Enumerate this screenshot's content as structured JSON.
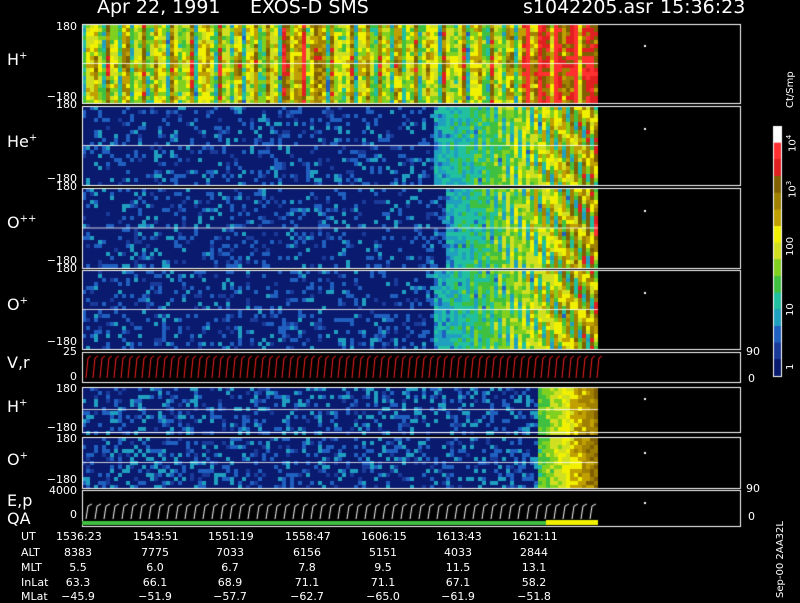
{
  "header": {
    "date": "Apr 22, 1991",
    "instrument": "EXOS-D SMS",
    "file": "s1042205.asr",
    "time": "15:36:23"
  },
  "colors": {
    "background": "#000000",
    "axis": "#ffffff",
    "vr_trace": "#ff2020",
    "ep_trace": "#ffffff",
    "qa_bar": "#40c040"
  },
  "panels": [
    {
      "id": "h-plus-1",
      "label": "H+",
      "ticks": {
        "top": "180",
        "bottom": "−180"
      },
      "onset": 0.05,
      "strength": 1.0
    },
    {
      "id": "he-plus",
      "label": "He+",
      "ticks": {
        "top": "180",
        "bottom": "−180"
      },
      "onset": 0.68,
      "strength": 0.9
    },
    {
      "id": "o-plus-plus",
      "label": "O++",
      "ticks": {
        "top": "180",
        "bottom": "−180"
      },
      "onset": 0.7,
      "strength": 0.95
    },
    {
      "id": "o-plus-1",
      "label": "O+",
      "ticks": {
        "top": "180",
        "bottom": "−180"
      },
      "onset": 0.68,
      "strength": 0.9
    },
    {
      "id": "h-plus-2",
      "label": "H+",
      "ticks": {
        "top": "180",
        "bottom": "−180"
      },
      "onset": 0.88,
      "strength": 0.8
    },
    {
      "id": "o-plus-2",
      "label": "O+",
      "ticks": {
        "top": "180",
        "bottom": "−180"
      },
      "onset": 0.88,
      "strength": 0.7
    }
  ],
  "vr_panel": {
    "label": "V,r",
    "left_ticks": [
      "25",
      "0"
    ],
    "right_ticks": [
      "90",
      "0"
    ]
  },
  "ep_panel": {
    "label": "E,p",
    "qa_label": "QA",
    "left_ticks": [
      "4000",
      "0"
    ],
    "right_ticks": [
      "90",
      "0"
    ]
  },
  "colorbar": {
    "unit": "Ct/Smp",
    "ticks": [
      {
        "base": "10",
        "exp": "4",
        "level": 4
      },
      {
        "base": "10",
        "exp": "3",
        "level": 3
      },
      {
        "base": "100",
        "exp": "",
        "level": 2
      },
      {
        "base": "10",
        "exp": "",
        "level": 1
      },
      {
        "base": "1",
        "exp": "",
        "level": 0
      }
    ]
  },
  "footer": {
    "row_labels": [
      "UT",
      "ALT",
      "MLT",
      "InLat",
      "MLat"
    ],
    "columns": [
      {
        "UT": "1536:23",
        "ALT": "8383",
        "MLT": "5.5",
        "InLat": "63.3",
        "MLat": "−45.9"
      },
      {
        "UT": "1543:51",
        "ALT": "7775",
        "MLT": "6.0",
        "InLat": "66.1",
        "MLat": "−51.9"
      },
      {
        "UT": "1551:19",
        "ALT": "7033",
        "MLT": "6.7",
        "InLat": "68.9",
        "MLat": "−57.7"
      },
      {
        "UT": "1558:47",
        "ALT": "6156",
        "MLT": "7.8",
        "InLat": "71.1",
        "MLat": "−62.7"
      },
      {
        "UT": "1606:15",
        "ALT": "5151",
        "MLT": "9.5",
        "InLat": "71.1",
        "MLat": "−65.0"
      },
      {
        "UT": "1613:43",
        "ALT": "4033",
        "MLT": "11.5",
        "InLat": "67.1",
        "MLat": "−61.9"
      },
      {
        "UT": "1621:11",
        "ALT": "2844",
        "MLT": "13.1",
        "InLat": "58.2",
        "MLat": "−51.8"
      }
    ],
    "side_note": "Sep-00  2AA32L"
  },
  "chart_data": {
    "type": "heatmap",
    "x_axis": "UT",
    "x_ticks": [
      "1536:23",
      "1543:51",
      "1551:19",
      "1558:47",
      "1606:15",
      "1613:43",
      "1621:11"
    ],
    "y_range": [
      -180,
      180
    ],
    "series": [
      {
        "name": "H+"
      },
      {
        "name": "He+"
      },
      {
        "name": "O++"
      },
      {
        "name": "O+"
      },
      {
        "name": "V,r"
      },
      {
        "name": "H+"
      },
      {
        "name": "O+"
      },
      {
        "name": "E,p"
      },
      {
        "name": "QA"
      }
    ],
    "color_scale": {
      "unit": "Ct/Smp",
      "min": 1,
      "max": 10000,
      "log": true
    }
  }
}
